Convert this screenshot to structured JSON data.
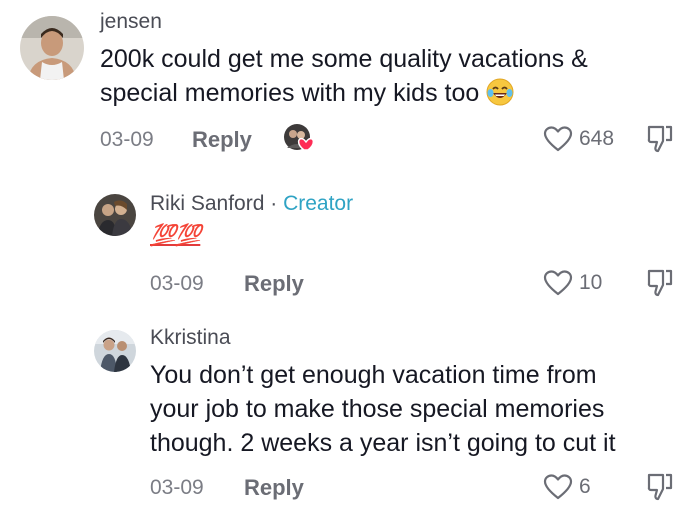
{
  "comments": [
    {
      "username": "jensen",
      "text_line1": "200k could get me some quality vacations &",
      "text_line2": "special memories with my kids too",
      "date": "03-09",
      "reply_label": "Reply",
      "likes": "648",
      "emoji_icon": "laughing-tears-emoji"
    },
    {
      "username": "Riki Sanford",
      "separator": "·",
      "creator_label": "Creator",
      "text": "💯💯",
      "date": "03-09",
      "reply_label": "Reply",
      "likes": "10"
    },
    {
      "username": "Kkristina",
      "text_line1": "You don’t get enough vacation time from",
      "text_line2": "your job to make those special memories",
      "text_line3": "though. 2 weeks a year isn’t going to cut it",
      "date": "03-09",
      "reply_label": "Reply",
      "likes": "6"
    }
  ],
  "colors": {
    "creator_accent": "#2fa3c4",
    "liked_heart": "#fe2c55",
    "muted_text": "#7b7d85"
  }
}
